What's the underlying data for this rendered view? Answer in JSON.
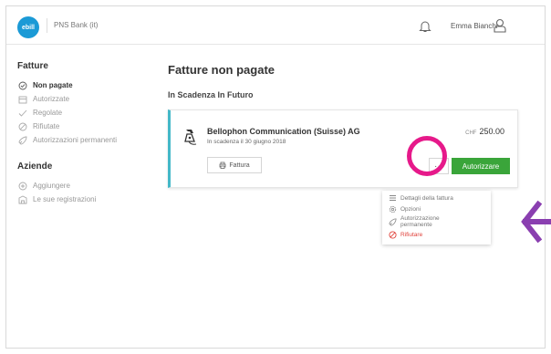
{
  "header": {
    "logo_text": "ebill",
    "bank_name": "PNS Bank (it)",
    "user_name": "Emma Bianchi"
  },
  "sidebar": {
    "section1_title": "Fatture",
    "items": [
      {
        "label": "Non pagate",
        "icon": "clock-check-icon",
        "active": true
      },
      {
        "label": "Autorizzate",
        "icon": "calendar-icon"
      },
      {
        "label": "Regolate",
        "icon": "check-icon"
      },
      {
        "label": "Rifiutate",
        "icon": "forbidden-icon"
      },
      {
        "label": "Autorizzazioni permanenti",
        "icon": "rocket-icon"
      }
    ],
    "section2_title": "Aziende",
    "items2": [
      {
        "label": "Aggiungere",
        "icon": "plus-circle-icon"
      },
      {
        "label": "Le sue registrazioni",
        "icon": "building-icon"
      }
    ]
  },
  "main": {
    "title": "Fatture non pagate",
    "subsection": "In Scadenza In Futuro"
  },
  "invoice": {
    "company": "Bellophon Communication (Suisse) AG",
    "due": "In scadenza il 30 giugno 2018",
    "currency": "CHF",
    "amount": "250.00",
    "fattura_label": "Fattura",
    "more_label": "···",
    "authorize_label": "Autorizzare"
  },
  "dropdown": {
    "items": [
      {
        "label": "Dettagli della fattura",
        "icon": "list-icon"
      },
      {
        "label": "Opzioni",
        "icon": "gear-icon"
      },
      {
        "label": "Autorizzazione permanente",
        "icon": "rocket-icon"
      },
      {
        "label": "Rifiutare",
        "icon": "forbidden-icon"
      }
    ]
  },
  "colors": {
    "accent": "#1b9ad6",
    "authorize_green": "#3aa53a",
    "highlight": "#e6198a",
    "arrow": "#8a3fb0",
    "danger": "#e0413a",
    "card_border": "#44b8c8"
  }
}
